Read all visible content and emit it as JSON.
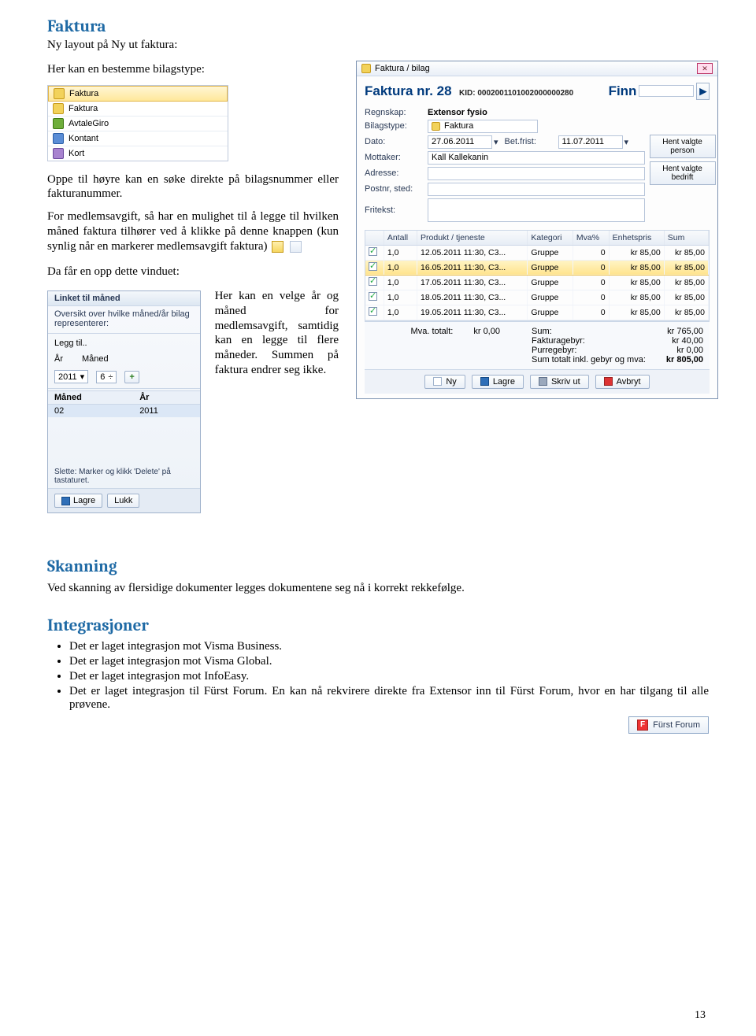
{
  "h1": "Faktura",
  "p1": "Ny layout på Ny ut faktura:",
  "p2": "Her kan en bestemme bilagstype:",
  "dropdown": {
    "items": [
      {
        "icon": "yellow",
        "label": "Faktura",
        "selected": true
      },
      {
        "icon": "yellow",
        "label": "Faktura"
      },
      {
        "icon": "green",
        "label": "AvtaleGiro"
      },
      {
        "icon": "blue",
        "label": "Kontant"
      },
      {
        "icon": "purple",
        "label": "Kort"
      }
    ]
  },
  "p3": "Oppe til høyre kan en søke direkte på bilagsnummer eller fakturanummer.",
  "p4": "For medlemsavgift, så har en mulighet til å legge til hvilken måned faktura tilhører ved å klikke på denne knappen (kun synlig når en markerer medlemsavgift faktura)",
  "p5": "Da får en opp dette vinduet:",
  "p6": "Her kan en velge år og måned for medlemsavgift, samtidig kan en legge til flere måneder. Summen på faktura endrer seg ikke.",
  "month_panel": {
    "header": "Linket til måned",
    "sub": "Oversikt over hvilke måned/år bilag representerer:",
    "legg_til": "Legg til..",
    "ar_label": "År",
    "maned_label": "Måned",
    "year_value": "2011",
    "month_value": "6",
    "table": {
      "headers": [
        "Måned",
        "År"
      ],
      "rows": [
        [
          "02",
          "2011"
        ]
      ]
    },
    "note": "Slette: Marker og klikk 'Delete' på tastaturet.",
    "btn_lagre": "Lagre",
    "btn_lukk": "Lukk"
  },
  "invoice_window": {
    "titlebar": "Faktura / bilag",
    "title_main": "Faktura nr. 28",
    "kid_label": "KID: 0002001101002000000280",
    "finn_label": "Finn",
    "labels": {
      "regnskap": "Regnskap:",
      "regnskap_val": "Extensor fysio",
      "bilagstype": "Bilagstype:",
      "bilagstype_val": "Faktura",
      "dato": "Dato:",
      "dato_val": "27.06.2011",
      "betfrist": "Bet.frist:",
      "betfrist_val": "11.07.2011",
      "mottaker": "Mottaker:",
      "mottaker_val": "Kall Kallekanin",
      "adresse": "Adresse:",
      "postnr": "Postnr, sted:",
      "fritekst": "Fritekst:"
    },
    "side_buttons": {
      "person": "Hent valgte person",
      "bedrift": "Hent valgte bedrift"
    },
    "columns": [
      "",
      "Antall",
      "Produkt / tjeneste",
      "Kategori",
      "Mva%",
      "Enhetspris",
      "Sum"
    ],
    "rows": [
      {
        "c": true,
        "a": "1,0",
        "p": "12.05.2011 11:30, C3...",
        "k": "Gruppe",
        "m": "0",
        "e": "kr 85,00",
        "s": "kr 85,00"
      },
      {
        "c": true,
        "a": "1,0",
        "p": "16.05.2011 11:30, C3...",
        "k": "Gruppe",
        "m": "0",
        "e": "kr 85,00",
        "s": "kr 85,00",
        "hl": true
      },
      {
        "c": true,
        "a": "1,0",
        "p": "17.05.2011 11:30, C3...",
        "k": "Gruppe",
        "m": "0",
        "e": "kr 85,00",
        "s": "kr 85,00"
      },
      {
        "c": true,
        "a": "1,0",
        "p": "18.05.2011 11:30, C3...",
        "k": "Gruppe",
        "m": "0",
        "e": "kr 85,00",
        "s": "kr 85,00"
      },
      {
        "c": true,
        "a": "1,0",
        "p": "19.05.2011 11:30, C3...",
        "k": "Gruppe",
        "m": "0",
        "e": "kr 85,00",
        "s": "kr 85,00"
      }
    ],
    "totals": {
      "mva_total_label": "Mva. totalt:",
      "mva_total": "kr 0,00",
      "sum_label": "Sum:",
      "sum": "kr 765,00",
      "gebyr_label": "Fakturagebyr:",
      "gebyr": "kr 40,00",
      "purre_label": "Purregebyr:",
      "purre": "kr 0,00",
      "tot_label": "Sum totalt inkl. gebyr og mva:",
      "tot": "kr 805,00"
    },
    "footer": {
      "ny": "Ny",
      "lagre": "Lagre",
      "skriv": "Skriv ut",
      "avbryt": "Avbryt"
    }
  },
  "skanning": {
    "h": "Skanning",
    "p": "Ved skanning av flersidige dokumenter legges dokumentene seg nå i korrekt rekkefølge."
  },
  "integrasjoner": {
    "h": "Integrasjoner",
    "items": [
      "Det er laget integrasjon mot Visma Business.",
      "Det er laget integrasjon mot Visma Global.",
      "Det er laget integrasjon mot InfoEasy.",
      "Det er laget integrasjon til Fürst Forum. En kan nå rekvirere direkte fra Extensor inn til Fürst Forum, hvor en har tilgang til alle prøvene."
    ],
    "badge": "Fürst Forum"
  },
  "page_number": "13"
}
